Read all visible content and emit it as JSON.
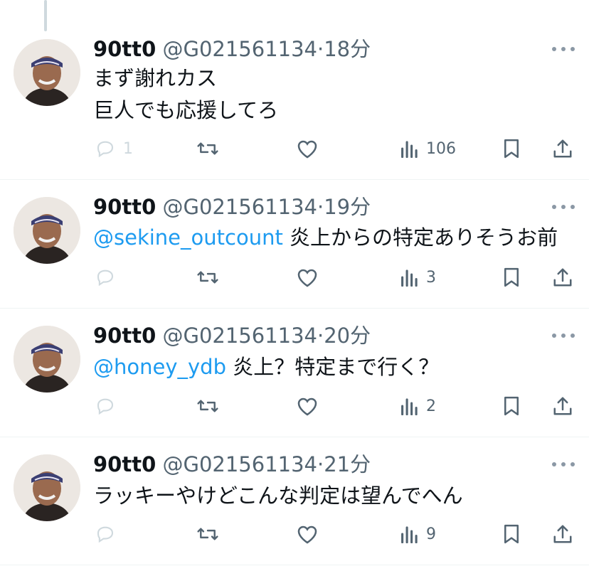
{
  "tweets": [
    {
      "name": "90tt0",
      "handle": "@G021561134",
      "dot": "·",
      "time": "18分",
      "mention": "",
      "body_lines": [
        "まず謝れカス",
        "巨人でも応援してろ"
      ],
      "reply_count": "1",
      "view_count": "106"
    },
    {
      "name": "90tt0",
      "handle": "@G021561134",
      "dot": "·",
      "time": "19分",
      "mention": "@sekine_outcount",
      "body_lines": [
        " 炎上からの特定ありそうお前"
      ],
      "reply_count": "",
      "view_count": "3"
    },
    {
      "name": "90tt0",
      "handle": "@G021561134",
      "dot": "·",
      "time": "20分",
      "mention": "@honey_ydb",
      "body_lines": [
        " 炎上？特定まで行く？"
      ],
      "reply_count": "",
      "view_count": "2"
    },
    {
      "name": "90tt0",
      "handle": "@G021561134",
      "dot": "·",
      "time": "21分",
      "mention": "",
      "body_lines": [
        "ラッキーやけどこんな判定は望んでへん"
      ],
      "reply_count": "",
      "view_count": "9"
    }
  ],
  "icons": [
    "reply-icon",
    "retweet-icon",
    "like-icon",
    "views-icon",
    "bookmark-icon",
    "share-icon",
    "more-icon"
  ],
  "colors": {
    "text": "#0f1419",
    "secondary": "#536471",
    "mention": "#1d9bf0",
    "divider": "#eff3f4"
  }
}
